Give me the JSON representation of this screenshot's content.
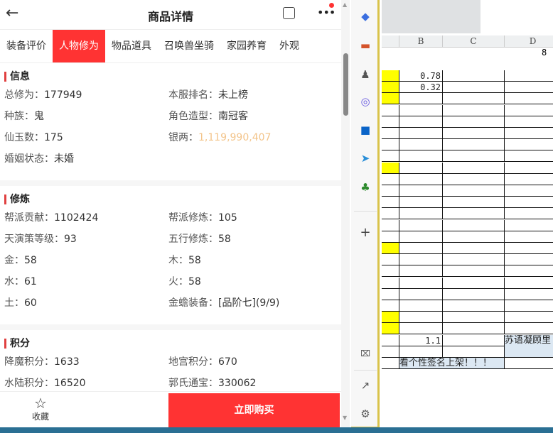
{
  "header": {
    "title": "商品详情",
    "back_icon": "arrow-left-icon",
    "share_icon": "share-icon",
    "more_icon": "more-icon"
  },
  "tabs": [
    {
      "label": "装备评价"
    },
    {
      "label": "人物修为",
      "active": true
    },
    {
      "label": "物品道具"
    },
    {
      "label": "召唤兽坐骑"
    },
    {
      "label": "家园养育"
    },
    {
      "label": "外观"
    }
  ],
  "sections": [
    {
      "title": "信息",
      "items": [
        {
          "label": "总修为：",
          "value": "177949"
        },
        {
          "label": "本服排名：",
          "value": "未上榜"
        },
        {
          "label": "种族：",
          "value": "鬼"
        },
        {
          "label": "角色造型：",
          "value": "南冠客"
        },
        {
          "label": "仙玉数：",
          "value": "175"
        },
        {
          "label": "银两：",
          "value": "1,119,990,407",
          "highlight": "#f3c48a"
        },
        {
          "label": "婚姻状态：",
          "value": "未婚"
        }
      ]
    },
    {
      "title": "修炼",
      "items": [
        {
          "label": "帮派贡献：",
          "value": "1102424"
        },
        {
          "label": "帮派修炼：",
          "value": "105"
        },
        {
          "label": "天演策等级：",
          "value": "93"
        },
        {
          "label": "五行修炼：",
          "value": "58"
        },
        {
          "label": "金：",
          "value": "58"
        },
        {
          "label": "木：",
          "value": "58"
        },
        {
          "label": "水：",
          "value": "61"
        },
        {
          "label": "火：",
          "value": "58"
        },
        {
          "label": "土：",
          "value": "60"
        },
        {
          "label": "金蟾装备：",
          "value": "[品阶七](9/9)"
        }
      ]
    },
    {
      "title": "积分",
      "items": [
        {
          "label": "降魔积分：",
          "value": "1633"
        },
        {
          "label": "地宫积分：",
          "value": "670"
        },
        {
          "label": "水陆积分：",
          "value": "16520"
        },
        {
          "label": "郭氏通宝：",
          "value": "330062"
        }
      ]
    }
  ],
  "bottom": {
    "favorite_label": "收藏",
    "buy_label": "立即购买",
    "accent": "#ff3333"
  },
  "sheet": {
    "columns": [
      "B",
      "C",
      "D"
    ],
    "top_value": "8",
    "rows": [
      {
        "yellow": true,
        "B": "0.78"
      },
      {
        "yellow": true,
        "B": "0.32"
      },
      {
        "yellow": true
      },
      {},
      {},
      {},
      {},
      {},
      {
        "yellow": true
      },
      {},
      {},
      {},
      {},
      {},
      {},
      {
        "yellow": true
      },
      {},
      {},
      {},
      {},
      {},
      {
        "yellow": true
      },
      {
        "yellow": true
      },
      {
        "B": "1.1",
        "D": "苏语凝顾里"
      },
      {},
      {
        "BC": "看个性签名上架！！！"
      }
    ]
  }
}
